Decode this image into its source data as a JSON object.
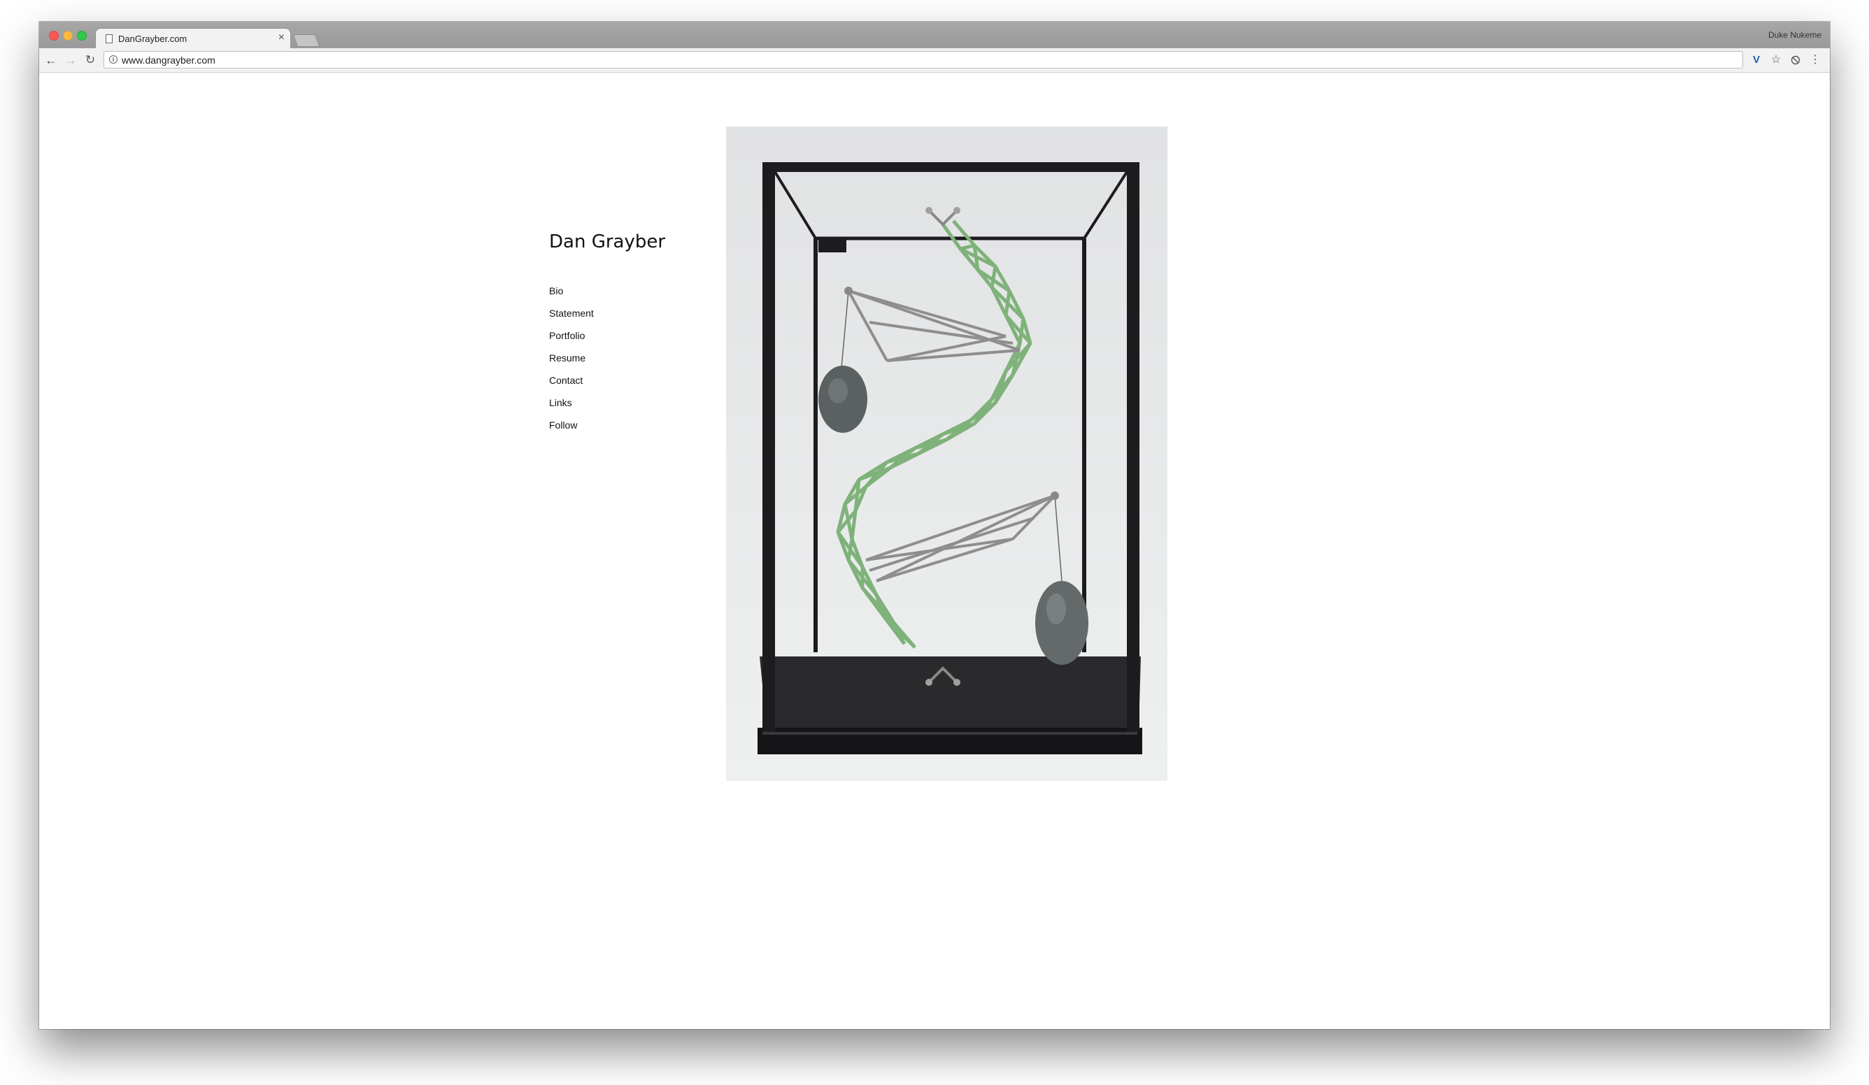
{
  "browser": {
    "tab_title": "DanGrayber.com",
    "tab_close": "×",
    "profile_name": "Duke Nukeme",
    "url": "www.dangrayber.com",
    "icons": {
      "back": "back-arrow-icon",
      "forward": "forward-arrow-icon",
      "reload": "reload-icon",
      "info": "info-icon",
      "extension": "v-extension-icon",
      "bookmark": "star-icon",
      "extension2": "shield-extension-icon",
      "menu": "kebab-menu-icon"
    },
    "extension_letter": "V",
    "info_glyph": "i"
  },
  "site": {
    "title": "Dan Grayber",
    "nav": [
      {
        "label": "Bio"
      },
      {
        "label": "Statement"
      },
      {
        "label": "Portfolio"
      },
      {
        "label": "Resume"
      },
      {
        "label": "Contact"
      },
      {
        "label": "Links"
      },
      {
        "label": "Follow"
      }
    ],
    "artwork_colors": {
      "background": "#e4e5e6",
      "frame": "#1c1c1e",
      "sculpture_green": "#7fb27a",
      "steel": "#9a9a9a",
      "stone": "#5a6160"
    }
  }
}
